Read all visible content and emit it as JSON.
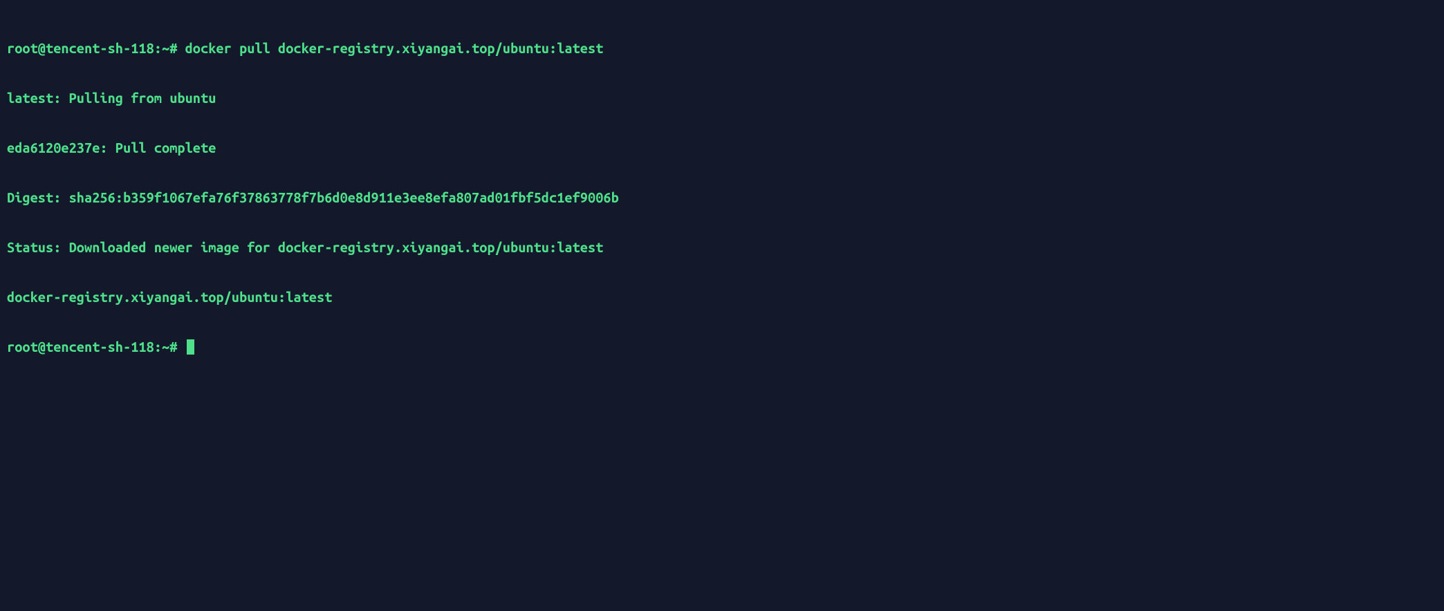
{
  "terminal": {
    "lines": [
      {
        "prompt": "root@tencent-sh-118:~# ",
        "command": "docker pull docker-registry.xiyangai.top/ubuntu:latest"
      },
      {
        "text": "latest: Pulling from ubuntu"
      },
      {
        "text": "eda6120e237e: Pull complete"
      },
      {
        "text": "Digest: sha256:b359f1067efa76f37863778f7b6d0e8d911e3ee8efa807ad01fbf5dc1ef9006b"
      },
      {
        "text": "Status: Downloaded newer image for docker-registry.xiyangai.top/ubuntu:latest"
      },
      {
        "text": "docker-registry.xiyangai.top/ubuntu:latest"
      },
      {
        "prompt": "root@tencent-sh-118:~# ",
        "cursor": true
      }
    ]
  }
}
